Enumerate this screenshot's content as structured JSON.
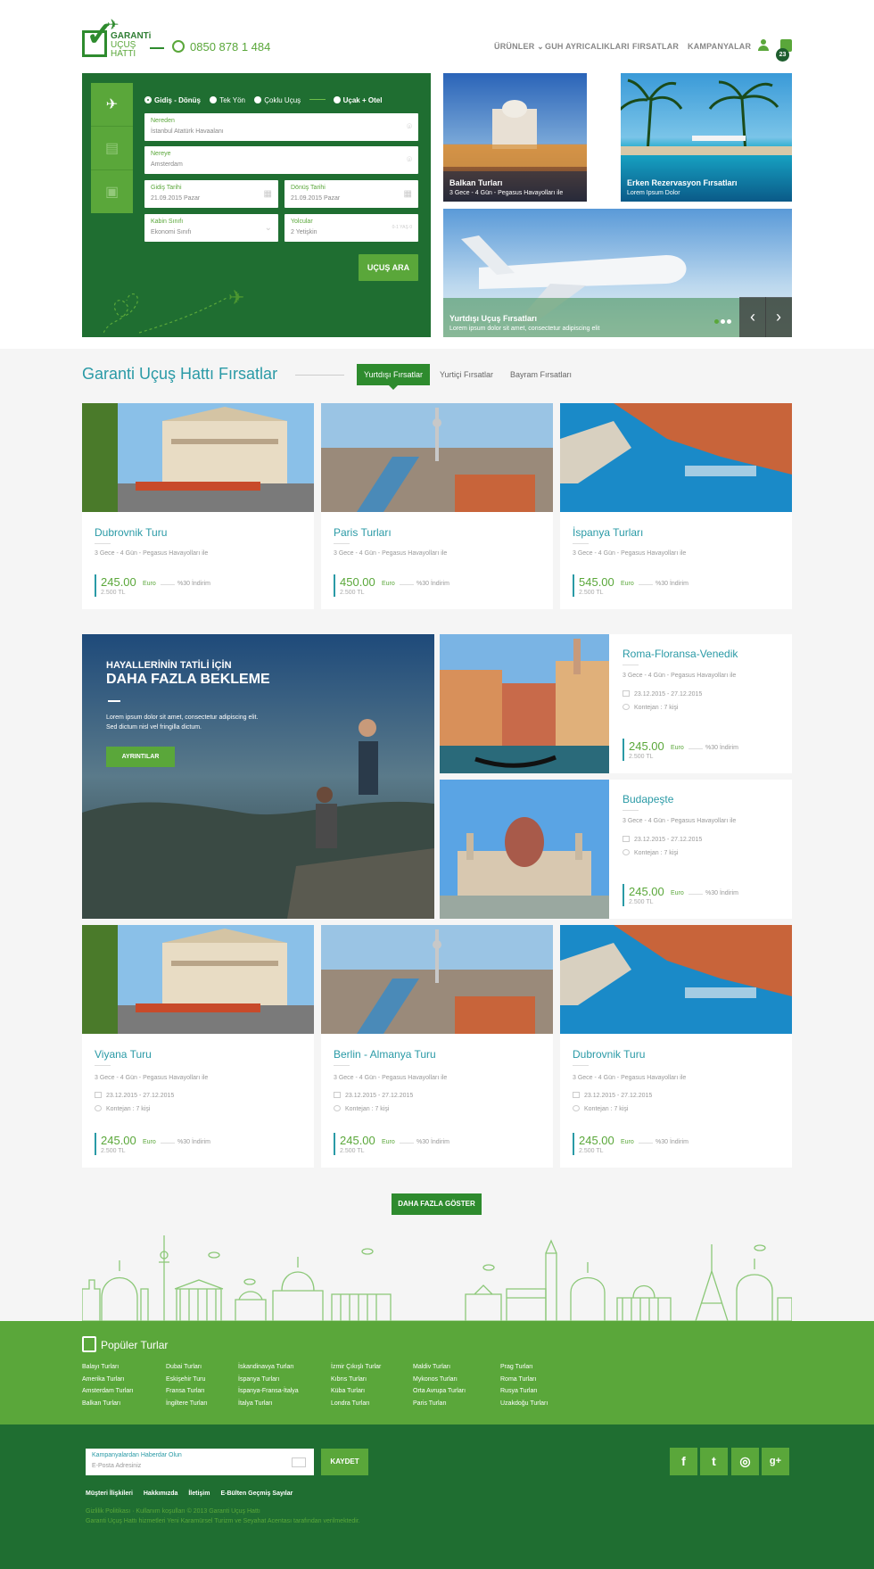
{
  "header": {
    "logo_line1": "GARANTi",
    "logo_line2": "UÇUŞ",
    "logo_line3": "HATTI",
    "phone": "0850 878 1 484",
    "nav": [
      "ÜRÜNLER",
      "GUH AYRICALIKLARI",
      "FIRSATLAR",
      "KAMPANYALAR"
    ],
    "cart_count": "23"
  },
  "search": {
    "trip_types": [
      "Gidiş - Dönüş",
      "Tek Yön",
      "Çoklu Uçuş",
      "Uçak + Otel"
    ],
    "from_label": "Nereden",
    "from_value": "İstanbul Atatürk Havaalanı",
    "to_label": "Nereye",
    "to_value": "Amsterdam",
    "depart_label": "Gidiş Tarihi",
    "depart_value": "21.09.2015 Pazar",
    "return_label": "Dönüş Tarihi",
    "return_value": "21.09.2015 Pazar",
    "cabin_label": "Kabin Sınıfı",
    "cabin_value": "Ekonomi Sınıfı",
    "pax_label": "Yolcular",
    "pax_value": "2 Yetişkin",
    "pax_hint": "0-1 YAŞ 0",
    "button": "UÇUŞ ARA"
  },
  "promos": [
    {
      "title": "Balkan Turları",
      "subtitle": "3 Gece - 4 Gün - Pegasus Havayolları ile"
    },
    {
      "title": "Erken Rezervasyon Fırsatları",
      "subtitle": "Lorem Ipsum Dolor"
    },
    {
      "title": "Yurtdışı Uçuş Fırsatları",
      "subtitle": "Lorem ipsum dolor sit amet, consectetur adipiscing elit"
    }
  ],
  "section": {
    "title": "Garanti Uçuş Hattı  Fırsatlar",
    "tabs": [
      "Yurtdışı Fırsatlar",
      "Yurtiçi Fırsatlar",
      "Bayram Fırsatları"
    ]
  },
  "cards_row1": [
    {
      "title": "Dubrovnik Turu",
      "desc": "3 Gece - 4 Gün - Pegasus Havayolları ile",
      "price": "245.00",
      "currency": "Euro",
      "old": "2.500 TL",
      "discount": "%30 İndirim"
    },
    {
      "title": "Paris Turları",
      "desc": "3 Gece - 4 Gün - Pegasus Havayolları ile",
      "price": "450.00",
      "currency": "Euro",
      "old": "2.500 TL",
      "discount": "%30 İndirim"
    },
    {
      "title": "İspanya Turları",
      "desc": "3 Gece - 4 Gün - Pegasus Havayolları ile",
      "price": "545.00",
      "currency": "Euro",
      "old": "2.500 TL",
      "discount": "%30 İndirim"
    }
  ],
  "hero": {
    "line1": "HAYALLERİNİN TATİLİ İÇİN",
    "line2": "DAHA FAZLA BEKLEME",
    "text1": "Lorem ipsum dolor sit amet, consectetur adipiscing elit.",
    "text2": "Sed dictum nisl vel fringilla dictum.",
    "button": "AYRINTILAR"
  },
  "side_cards": [
    {
      "title": "Roma-Floransa-Venedik",
      "desc": "3 Gece - 4 Gün - Pegasus Havayolları ile",
      "dates": "23.12.2015 - 27.12.2015",
      "quota": "Kontejan : 7 kişi",
      "price": "245.00",
      "currency": "Euro",
      "old": "2.500 TL",
      "discount": "%30 İndirim"
    },
    {
      "title": "Budapeşte",
      "desc": "3 Gece - 4 Gün - Pegasus Havayolları ile",
      "dates": "23.12.2015 - 27.12.2015",
      "quota": "Kontejan : 7 kişi",
      "price": "245.00",
      "currency": "Euro",
      "old": "2.500 TL",
      "discount": "%30 İndirim"
    }
  ],
  "cards_row2": [
    {
      "title": "Viyana Turu",
      "desc": "3 Gece - 4 Gün - Pegasus Havayolları ile",
      "dates": "23.12.2015 - 27.12.2015",
      "quota": "Kontejan : 7 kişi",
      "price": "245.00",
      "currency": "Euro",
      "old": "2.500 TL",
      "discount": "%30 İndirim"
    },
    {
      "title": "Berlin - Almanya Turu",
      "desc": "3 Gece - 4 Gün - Pegasus Havayolları ile",
      "dates": "23.12.2015 - 27.12.2015",
      "quota": "Kontejan : 7 kişi",
      "price": "245.00",
      "currency": "Euro",
      "old": "2.500 TL",
      "discount": "%30 İndirim"
    },
    {
      "title": "Dubrovnik Turu",
      "desc": "3 Gece - 4 Gün - Pegasus Havayolları ile",
      "dates": "23.12.2015 - 27.12.2015",
      "quota": "Kontejan : 7 kişi",
      "price": "245.00",
      "currency": "Euro",
      "old": "2.500 TL",
      "discount": "%30 İndirim"
    }
  ],
  "more_button": "DAHA FAZLA GÖSTER",
  "footer": {
    "popular_title": "Popüler Turlar",
    "columns": [
      [
        "Balayı Turları",
        "Amerika Turları",
        "Amsterdam Turları",
        "Balkan Turları"
      ],
      [
        "Dubai Turları",
        "Eskişehir Turu",
        "Fransa Turları",
        "İngiltere Turları"
      ],
      [
        "İskandinavya Turları",
        "İspanya Turları",
        "İspanya-Fransa-İtalya",
        "İtalya Turları"
      ],
      [
        "İzmir Çıkışlı Turlar",
        "Kıbrıs Turları",
        "Küba Turları",
        "Londra Turları"
      ],
      [
        "Maldiv Turları",
        "Mykonos Turları",
        "Orta Avrupa Turları",
        "Paris Turları"
      ],
      [
        "Prag Turları",
        "Roma Turları",
        "Rusya Turları",
        "Uzakdoğu Turları"
      ]
    ],
    "newsletter_label": "Kampanyalardan Haberdar Olun",
    "newsletter_placeholder": "E-Posta Adresiniz",
    "save": "KAYDET",
    "links": [
      "Müşteri İlişkileri",
      "Hakkımızda",
      "İletişim",
      "E-Bülten Geçmiş Sayılar"
    ],
    "copy1": "Gizlilik Politikası · Kullanım koşulları   © 2013 Garanti Uçuş Hattı",
    "copy2": "Garanti Uçuş Hattı hizmetleri Yeni Karamürsel Turizm ve Seyahat Acentası tarafından verilmektedir.",
    "social": [
      "f",
      "t",
      "◎",
      "g+"
    ]
  },
  "colors": {
    "dark_green": "#1f6e31",
    "green": "#5aa73a",
    "teal": "#2a9aa6"
  }
}
